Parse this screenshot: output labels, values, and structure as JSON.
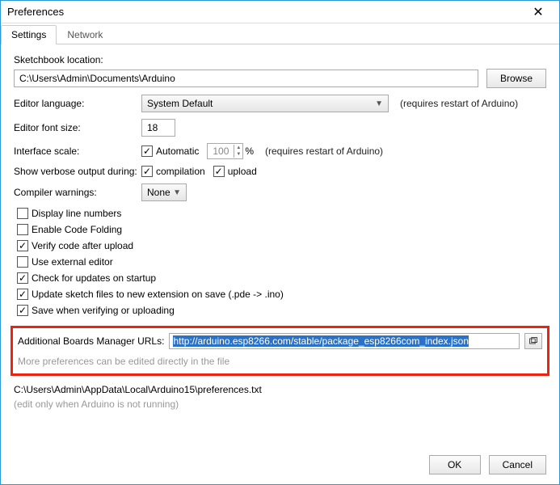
{
  "window": {
    "title": "Preferences"
  },
  "tabs": {
    "settings": "Settings",
    "network": "Network"
  },
  "sketchbook": {
    "label": "Sketchbook location:",
    "path": "C:\\Users\\Admin\\Documents\\Arduino",
    "browse": "Browse"
  },
  "editorLang": {
    "label": "Editor language:",
    "value": "System Default",
    "note": "(requires restart of Arduino)"
  },
  "fontSize": {
    "label": "Editor font size:",
    "value": "18"
  },
  "scale": {
    "label": "Interface scale:",
    "auto": "Automatic",
    "autoChecked": true,
    "value": "100",
    "pct": "%",
    "note": "(requires restart of Arduino)"
  },
  "verbose": {
    "label": "Show verbose output during:",
    "compilation": "compilation",
    "compilationChecked": true,
    "upload": "upload",
    "uploadChecked": true
  },
  "warnings": {
    "label": "Compiler warnings:",
    "value": "None"
  },
  "opts": {
    "lineNumbers": {
      "label": "Display line numbers",
      "checked": false
    },
    "codeFolding": {
      "label": "Enable Code Folding",
      "checked": false
    },
    "verify": {
      "label": "Verify code after upload",
      "checked": true
    },
    "extEditor": {
      "label": "Use external editor",
      "checked": false
    },
    "updates": {
      "label": "Check for updates on startup",
      "checked": true
    },
    "updateExt": {
      "label": "Update sketch files to new extension on save (.pde -> .ino)",
      "checked": true
    },
    "saveOnVerify": {
      "label": "Save when verifying or uploading",
      "checked": true
    }
  },
  "boards": {
    "label": "Additional Boards Manager URLs:",
    "url": "http://arduino.esp8266.com/stable/package_esp8266com_index.json",
    "hint": "More preferences can be edited directly in the file"
  },
  "prefsFile": {
    "path": "C:\\Users\\Admin\\AppData\\Local\\Arduino15\\preferences.txt",
    "note": "(edit only when Arduino is not running)"
  },
  "buttons": {
    "ok": "OK",
    "cancel": "Cancel"
  }
}
